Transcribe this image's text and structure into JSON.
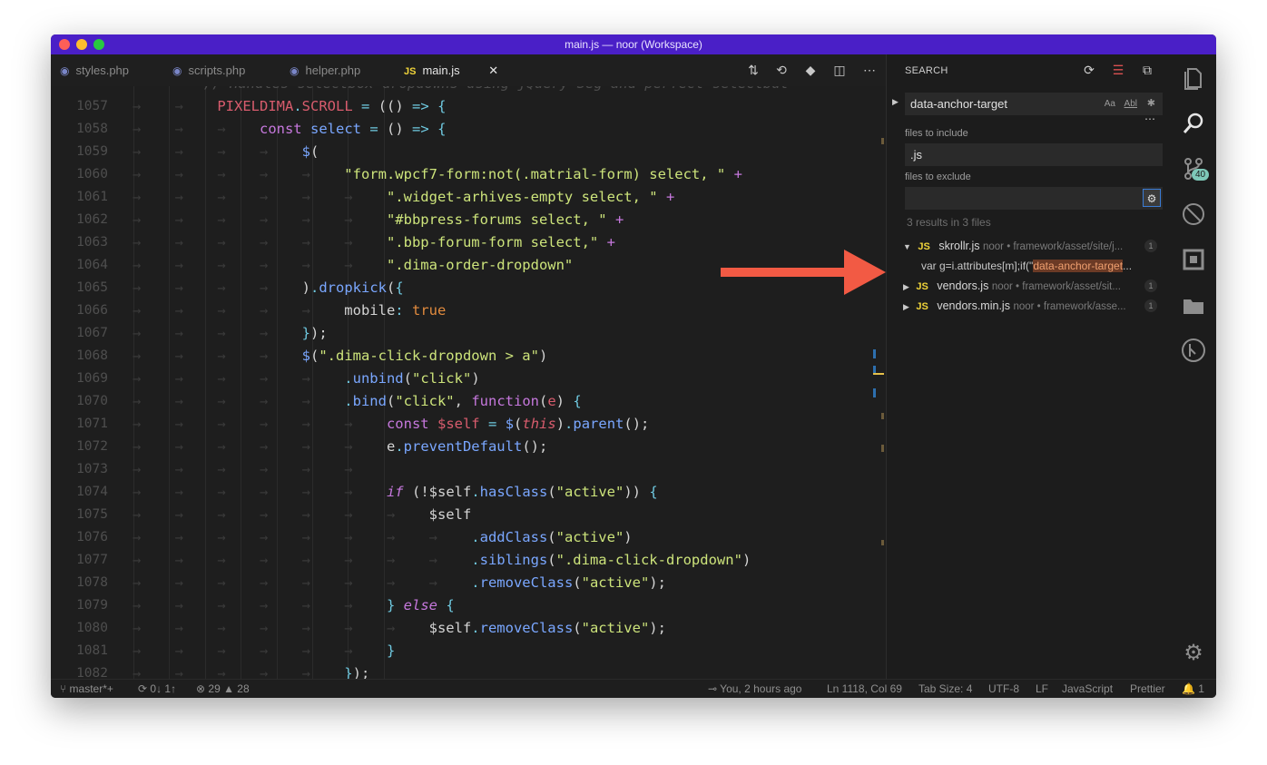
{
  "window": {
    "title": "main.js — noor (Workspace)"
  },
  "tabs": [
    {
      "label": "styles.php",
      "icon": "php-icon"
    },
    {
      "label": "scripts.php",
      "icon": "php-icon"
    },
    {
      "label": "helper.php",
      "icon": "php-icon"
    },
    {
      "label": "main.js",
      "icon": "js-icon",
      "active": true
    }
  ],
  "editor": {
    "partial_top_line": "// Handles selectbox dropdowns using jQuery Seg and perfect selectbut",
    "lines": [
      {
        "num": "1057"
      },
      {
        "num": "1058"
      },
      {
        "num": "1059"
      },
      {
        "num": "1060"
      },
      {
        "num": "1061"
      },
      {
        "num": "1062"
      },
      {
        "num": "1063"
      },
      {
        "num": "1064"
      },
      {
        "num": "1065"
      },
      {
        "num": "1066"
      },
      {
        "num": "1067"
      },
      {
        "num": "1068"
      },
      {
        "num": "1069"
      },
      {
        "num": "1070"
      },
      {
        "num": "1071"
      },
      {
        "num": "1072"
      },
      {
        "num": "1073"
      },
      {
        "num": "1074"
      },
      {
        "num": "1075"
      },
      {
        "num": "1076"
      },
      {
        "num": "1077"
      },
      {
        "num": "1078"
      },
      {
        "num": "1079"
      },
      {
        "num": "1080"
      },
      {
        "num": "1081"
      },
      {
        "num": "1082"
      }
    ],
    "text": {
      "pixeldima": "PIXELDIMA",
      "scroll": "SCROLL",
      "const": "const",
      "select": "select",
      "dollar": "$",
      "s1060": "\"form.wpcf7-form:not(.matrial-form) select, \"",
      "s1061": "\".widget-arhives-empty select, \"",
      "s1062": "\"#bbpress-forums select, \"",
      "s1063": "\".bbp-forum-form select,\"",
      "s1064": "\".dima-order-dropdown\"",
      "dropkick": "dropkick",
      "mobile": "mobile",
      "true": "true",
      "s1068": "\".dima-click-dropdown > a\"",
      "unbind": "unbind",
      "click": "\"click\"",
      "bind": "bind",
      "function": "function",
      "e": "e",
      "self": "$self",
      "this": "this",
      "parent": "parent",
      "preventDefault": "preventDefault",
      "if": "if",
      "hasClass": "hasClass",
      "active": "\"active\"",
      "addClass": "addClass",
      "siblings": "siblings",
      "s1077": "\".dima-click-dropdown\"",
      "removeClass": "removeClass",
      "else": "else"
    }
  },
  "search": {
    "title": "SEARCH",
    "query": "data-anchor-target",
    "match_case": "Aa",
    "whole_word": "Abl",
    "include_label": "files to include",
    "include_value": ".js",
    "exclude_label": "files to exclude",
    "exclude_value": "",
    "summary": "3 results in 3 files",
    "results": [
      {
        "file": "skrollr.js",
        "path": "noor • framework/asset/site/j...",
        "count": "1",
        "expanded": true,
        "match_prefix": "var g=i.attributes[m];if(\"",
        "match_hit": "data-anchor-target",
        "match_suffix": "..."
      },
      {
        "file": "vendors.js",
        "path": "noor • framework/asset/sit...",
        "count": "1"
      },
      {
        "file": "vendors.min.js",
        "path": "noor • framework/asse...",
        "count": "1"
      }
    ]
  },
  "activity_bar": {
    "scm_badge": "40"
  },
  "status": {
    "branch": "master*+",
    "sync": "0↓ 1↑",
    "errors": "29",
    "warnings": "28",
    "blame": "You, 2 hours ago",
    "position": "Ln 1118, Col 69",
    "tab_size": "Tab Size: 4",
    "encoding": "UTF-8",
    "eol": "LF",
    "language": "JavaScript",
    "formatter": "Prettier",
    "notifications": "1"
  },
  "colors": {
    "titlebar": "#4a1fc7",
    "accent_string": "#cde47b",
    "accent_function": "#7aa7ff",
    "accent_keyword": "#c678dd",
    "arrow": "#f25a44"
  }
}
